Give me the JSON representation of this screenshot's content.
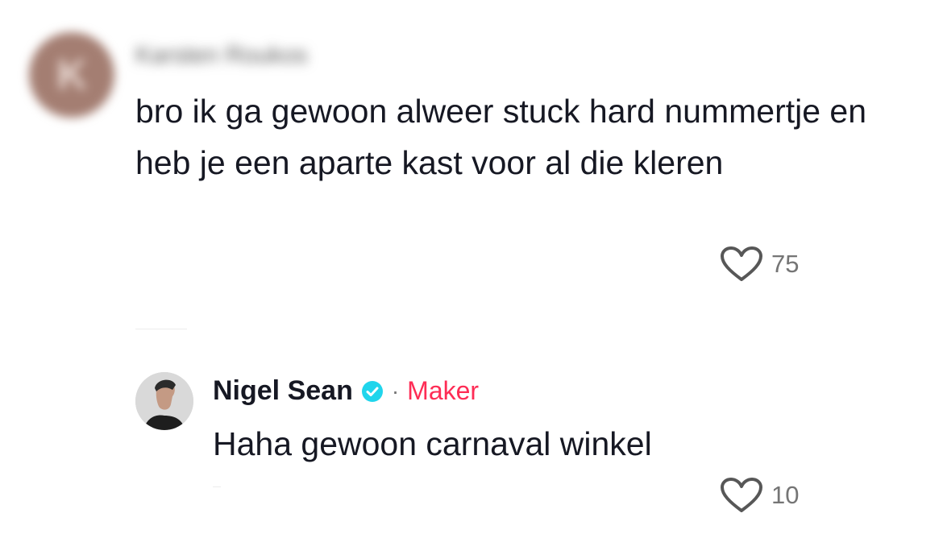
{
  "comment": {
    "avatar_letter": "K",
    "username": "Karsten Roukos",
    "text": "bro ik ga gewoon alweer stuck hard nummertje en heb je een aparte kast voor al die kleren",
    "likes": "75",
    "heart_icon": "heart-outline-icon"
  },
  "reply": {
    "name": "Nigel Sean",
    "verified_icon": "verified-badge-icon",
    "separator": "·",
    "role_label": "Maker",
    "text": "Haha gewoon carnaval winkel",
    "likes": "10",
    "heart_icon": "heart-outline-icon"
  },
  "colors": {
    "text": "#161823",
    "secondary": "#757575",
    "maker": "#fe2c55",
    "verified": "#20d5ec",
    "avatar_k": "#a47e72"
  }
}
